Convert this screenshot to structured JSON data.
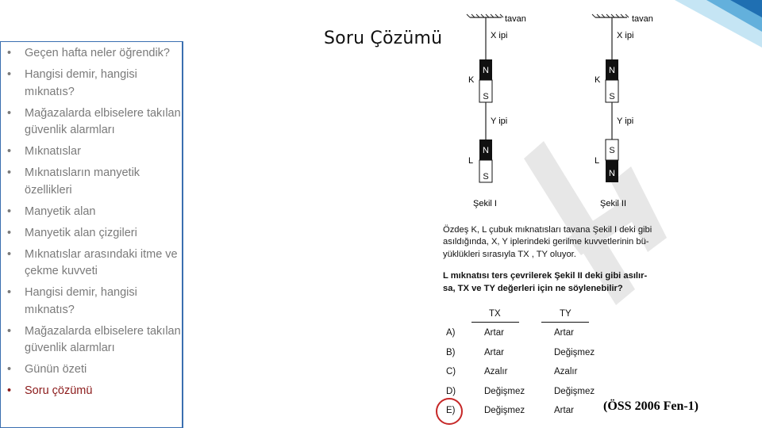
{
  "sidebar": {
    "items": [
      {
        "label": "Geçen hafta neler öğrendik?"
      },
      {
        "label": "Hangisi demir, hangisi mıknatıs?"
      },
      {
        "label": "Mağazalarda elbiselere takılan güvenlik alarmları"
      },
      {
        "label": "Mıknatıslar"
      },
      {
        "label": "Mıknatısların manyetik özellikleri"
      },
      {
        "label": "Manyetik alan"
      },
      {
        "label": "Manyetik alan çizgileri"
      },
      {
        "label": "Mıknatıslar arasındaki itme ve çekme kuvveti"
      },
      {
        "label": "Hangisi demir, hangisi mıknatıs?"
      },
      {
        "label": "Mağazalarda elbiselere takılan güvenlik alarmları"
      },
      {
        "label": "Günün özeti"
      },
      {
        "label": "Soru çözümü"
      }
    ],
    "bullet": "•"
  },
  "slide": {
    "title": "Soru Çözümü"
  },
  "figure": {
    "ceiling_label": "tavan",
    "x_rope": "X ipi",
    "y_rope": "Y ipi",
    "k_label": "K",
    "l_label": "L",
    "north": "N",
    "south": "S",
    "fig1_caption": "Şekil I",
    "fig2_caption": "Şekil II"
  },
  "question": {
    "line1": "Özdeş K, L çubuk mıknatısları tavana Şekil I deki gibi",
    "line2": "asıldığında, X, Y iplerindeki gerilme kuvvetlerinin bü-",
    "line3": "yüklükleri sırasıyla  TX , TY  oluyor.",
    "line4": "L mıknatısı ters çevrilerek Şekil II deki gibi asılır-",
    "line5": "sa, TX  ve  TY  değerleri için ne söylenebilir?",
    "col_tx": "TX",
    "col_ty": "TY"
  },
  "options": [
    {
      "letter": "A)",
      "tx": "Artar",
      "ty": "Artar"
    },
    {
      "letter": "B)",
      "tx": "Artar",
      "ty": "Değişmez"
    },
    {
      "letter": "C)",
      "tx": "Azalır",
      "ty": "Azalır"
    },
    {
      "letter": "D)",
      "tx": "Değişmez",
      "ty": "Değişmez"
    },
    {
      "letter": "E)",
      "tx": "Değişmez",
      "ty": "Artar"
    }
  ],
  "answer_marker_color": "#c62828",
  "source": "(ÖSS 2006 Fen-1)"
}
